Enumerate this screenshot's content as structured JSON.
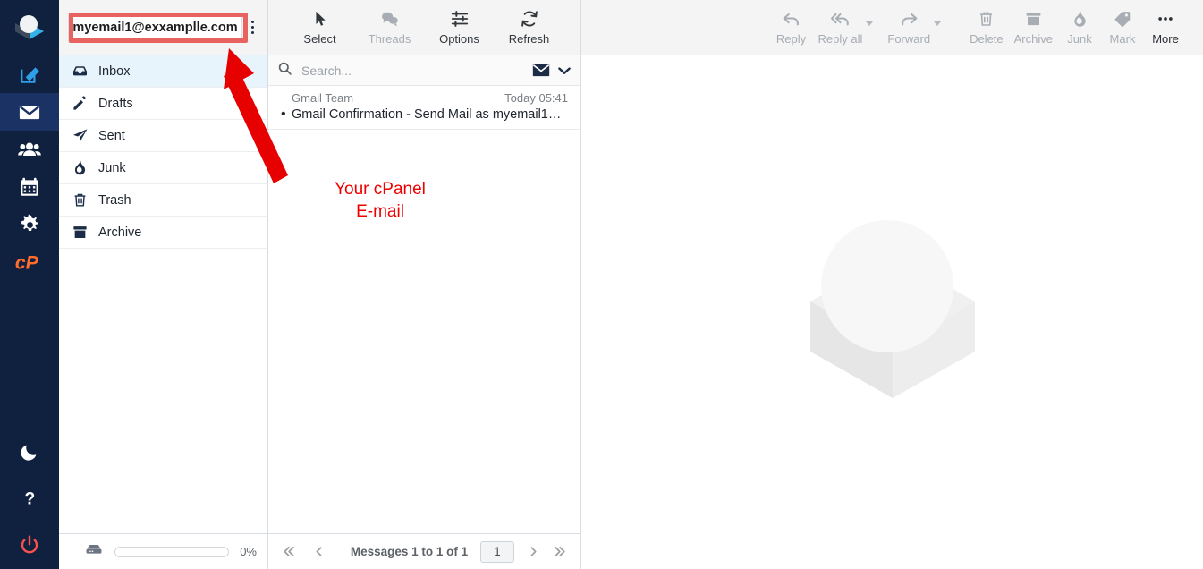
{
  "rail": {
    "items": [
      {
        "name": "roundcube-logo",
        "label": "Roundcube"
      },
      {
        "name": "compose",
        "label": "Compose"
      },
      {
        "name": "mail",
        "label": "Mail"
      },
      {
        "name": "contacts",
        "label": "Contacts"
      },
      {
        "name": "calendar",
        "label": "Calendar"
      },
      {
        "name": "settings",
        "label": "Settings"
      },
      {
        "name": "cpanel",
        "label": "cPanel"
      }
    ],
    "bottom": [
      {
        "name": "dark-mode",
        "label": "Dark mode"
      },
      {
        "name": "help",
        "label": "Help"
      },
      {
        "name": "logout",
        "label": "Logout"
      }
    ],
    "logout_color": "#f5524d",
    "cpanel_color": "#ff6c2c",
    "active_bg": "#1b3264",
    "bg": "#10203f"
  },
  "account": {
    "email": "myemail1@exxamplle.com",
    "menu_name": "account-options-menu",
    "highlight_color": "#e8635f"
  },
  "folders": {
    "items": [
      {
        "label": "Inbox",
        "icon": "inbox-icon",
        "selected": true
      },
      {
        "label": "Drafts",
        "icon": "pencil-icon",
        "selected": false
      },
      {
        "label": "Sent",
        "icon": "paper-plane-icon",
        "selected": false
      },
      {
        "label": "Junk",
        "icon": "flame-icon",
        "selected": false
      },
      {
        "label": "Trash",
        "icon": "trash-icon",
        "selected": false
      },
      {
        "label": "Archive",
        "icon": "archive-box-icon",
        "selected": false
      }
    ],
    "selected_bg": "#e7f4fb"
  },
  "quota": {
    "icon": "disk-icon",
    "percent": "0%",
    "fill": 0
  },
  "list_toolbar": {
    "buttons": [
      {
        "label": "Select",
        "icon": "cursor-arrow-icon",
        "disabled": false
      },
      {
        "label": "Threads",
        "icon": "threads-icon",
        "disabled": true
      },
      {
        "label": "Options",
        "icon": "sliders-icon",
        "disabled": false
      },
      {
        "label": "Refresh",
        "icon": "refresh-icon",
        "disabled": false
      }
    ]
  },
  "search": {
    "placeholder": "Search...",
    "value": "",
    "scope_icon": "envelope-icon",
    "chevron_icon": "chevron-down-icon"
  },
  "messages": [
    {
      "sender": "Gmail Team",
      "date": "Today 05:41",
      "subject": "Gmail Confirmation - Send Mail as myemail1…",
      "unread": true
    }
  ],
  "pager": {
    "first": "«",
    "prev": "‹",
    "status": "Messages 1 to 1 of 1",
    "page": "1",
    "next": "›",
    "last": "»"
  },
  "view_toolbar": {
    "buttons": [
      {
        "label": "Reply",
        "icon": "reply-icon",
        "disabled": true,
        "caret": false
      },
      {
        "label": "Reply all",
        "icon": "reply-all-icon",
        "disabled": true,
        "caret": true
      },
      {
        "label": "Forward",
        "icon": "forward-icon",
        "disabled": true,
        "caret": true
      },
      {
        "label": "Delete",
        "icon": "trash-icon",
        "disabled": true,
        "caret": false
      },
      {
        "label": "Archive",
        "icon": "archive-box-icon",
        "disabled": true,
        "caret": false
      },
      {
        "label": "Junk",
        "icon": "flame-icon",
        "disabled": true,
        "caret": false
      },
      {
        "label": "Mark",
        "icon": "tag-icon",
        "disabled": true,
        "caret": false
      },
      {
        "label": "More",
        "icon": "ellipsis-icon",
        "disabled": false,
        "caret": false
      }
    ]
  },
  "view_body": {
    "watermark_icon": "roundcube-watermark-logo"
  },
  "annotation": {
    "line1": "Your cPanel",
    "line2": "E-mail",
    "color": "#ee0000",
    "arrow_color": "#e60000"
  }
}
